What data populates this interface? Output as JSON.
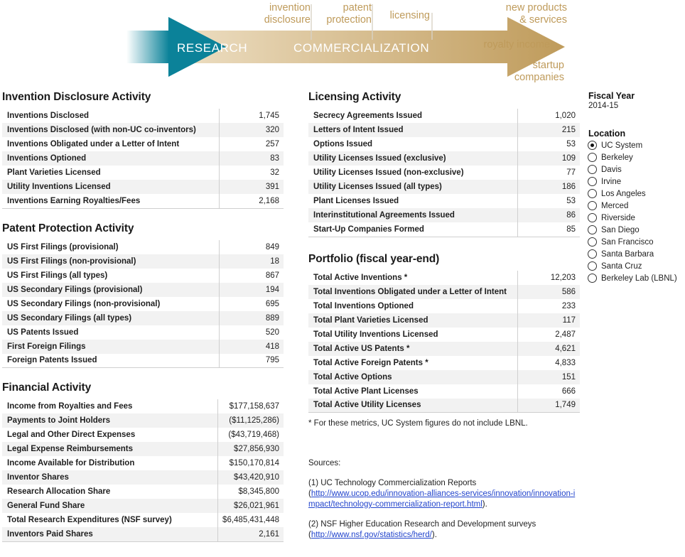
{
  "banner": {
    "research_label": "RESEARCH",
    "commercialization_label": "COMMERCIALIZATION",
    "stage_labels": {
      "invention_disclosure": "invention\ndisclosure",
      "patent_protection": "patent\nprotection",
      "licensing": "licensing",
      "new_products": "new products\n& services",
      "royalty_income": "royalty income",
      "startup_companies": "startup\ncompanies"
    },
    "colors": {
      "teal": "#0b8299",
      "gold": "#bf9b5b",
      "label_text": "#bf9b5b"
    }
  },
  "sections": {
    "invention_disclosure": {
      "title": "Invention Disclosure Activity",
      "rows": [
        {
          "label": "Inventions Disclosed",
          "value": "1,745"
        },
        {
          "label": "Inventions Disclosed (with non-UC co-inventors)",
          "value": "320"
        },
        {
          "label": "Inventions Obligated under a Letter of Intent",
          "value": "257"
        },
        {
          "label": "Inventions Optioned",
          "value": "83"
        },
        {
          "label": "Plant Varieties Licensed",
          "value": "32"
        },
        {
          "label": "Utility Inventions Licensed",
          "value": "391"
        },
        {
          "label": "Inventions Earning Royalties/Fees",
          "value": "2,168"
        }
      ]
    },
    "patent_protection": {
      "title": "Patent Protection Activity",
      "rows": [
        {
          "label": "US First Filings (provisional)",
          "value": "849"
        },
        {
          "label": "US First Filings (non-provisional)",
          "value": "18"
        },
        {
          "label": "US First Filings (all types)",
          "value": "867"
        },
        {
          "label": "US Secondary Filings (provisional)",
          "value": "194"
        },
        {
          "label": "US Secondary Filings (non-provisional)",
          "value": "695"
        },
        {
          "label": "US Secondary Filings (all types)",
          "value": "889"
        },
        {
          "label": "US Patents Issued",
          "value": "520"
        },
        {
          "label": "First Foreign Filings",
          "value": "418"
        },
        {
          "label": "Foreign Patents Issued",
          "value": "795"
        }
      ]
    },
    "financial": {
      "title": "Financial Activity",
      "rows": [
        {
          "label": "Income from Royalties and Fees",
          "value": "$177,158,637"
        },
        {
          "label": "Payments to Joint Holders",
          "value": "($11,125,286)"
        },
        {
          "label": "Legal and Other Direct Expenses",
          "value": "($43,719,468)"
        },
        {
          "label": "Legal Expense Reimbursements",
          "value": "$27,856,930"
        },
        {
          "label": "Income Available for Distribution",
          "value": "$150,170,814"
        },
        {
          "label": "Inventor Shares",
          "value": "$43,420,910"
        },
        {
          "label": "Research Allocation Share",
          "value": "$8,345,800"
        },
        {
          "label": "General Fund Share",
          "value": "$26,021,961"
        },
        {
          "label": "Total Research Expenditures (NSF survey)",
          "value": "$6,485,431,448"
        },
        {
          "label": "Inventors Paid Shares",
          "value": "2,161"
        }
      ]
    },
    "licensing": {
      "title": "Licensing Activity",
      "rows": [
        {
          "label": "Secrecy Agreements Issued",
          "value": "1,020"
        },
        {
          "label": "Letters of Intent Issued",
          "value": "215"
        },
        {
          "label": "Options Issued",
          "value": "53"
        },
        {
          "label": "Utility Licenses Issued (exclusive)",
          "value": "109"
        },
        {
          "label": "Utility Licenses Issued (non-exclusive)",
          "value": "77"
        },
        {
          "label": "Utility Licenses Issued (all types)",
          "value": "186"
        },
        {
          "label": "Plant Licenses Issued",
          "value": "53"
        },
        {
          "label": "Interinstitutional Agreements Issued",
          "value": "86"
        },
        {
          "label": "Start-Up Companies Formed",
          "value": "85"
        }
      ]
    },
    "portfolio": {
      "title": "Portfolio (fiscal year-end)",
      "rows": [
        {
          "label": "Total Active Inventions *",
          "value": "12,203"
        },
        {
          "label": "Total Inventions Obligated under a Letter of Intent",
          "value": "586"
        },
        {
          "label": "Total Inventions Optioned",
          "value": "233"
        },
        {
          "label": "Total Plant Varieties Licensed",
          "value": "117"
        },
        {
          "label": "Total Utility Inventions Licensed",
          "value": "2,487"
        },
        {
          "label": "Total Active US Patents *",
          "value": "4,621"
        },
        {
          "label": "Total Active Foreign Patents *",
          "value": "4,833"
        },
        {
          "label": "Total Active Options",
          "value": "151"
        },
        {
          "label": "Total Active Plant Licenses",
          "value": "666"
        },
        {
          "label": "Total Active Utility Licenses",
          "value": "1,749"
        }
      ],
      "footnote": "* For these metrics, UC System figures do not include LBNL."
    }
  },
  "sources": {
    "heading": "Sources:",
    "item1_prefix": "(1) UC Technology Commercialization Reports",
    "item1_open": "(",
    "item1_url": "http://www.ucop.edu/innovation-alliances-services/innovation/innovation-impact/technology-commercialization-report.html",
    "item1_close": ").",
    "item2_prefix": "(2) NSF Higher Education Research and Development surveys",
    "item2_open": "(",
    "item2_url": "http://www.nsf.gov/statistics/herd/",
    "item2_close": ")."
  },
  "filters": {
    "fiscal_year": {
      "title": "Fiscal Year",
      "value": "2014-15"
    },
    "location": {
      "title": "Location",
      "selected": "UC System",
      "options": [
        "UC System",
        "Berkeley",
        "Davis",
        "Irvine",
        "Los Angeles",
        "Merced",
        "Riverside",
        "San Diego",
        "San Francisco",
        "Santa Barbara",
        "Santa Cruz",
        "Berkeley Lab (LBNL)"
      ]
    }
  }
}
